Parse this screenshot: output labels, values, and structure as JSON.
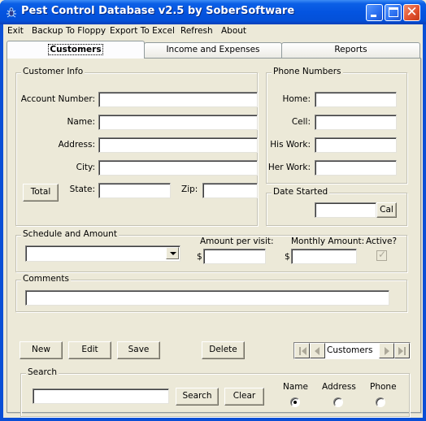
{
  "window": {
    "title": "Pest Control Database v2.5 by SoberSoftware",
    "app_icon": "bug-icon",
    "controls": [
      "minimize-icon",
      "maximize-icon",
      "close-icon"
    ],
    "close_glyph": "✕"
  },
  "menu": {
    "items": [
      {
        "label": "Exit"
      },
      {
        "label": "Backup To Floppy"
      },
      {
        "label": "Export To Excel"
      },
      {
        "label": "Refresh"
      },
      {
        "label": "About"
      }
    ]
  },
  "tabs": [
    {
      "label": "Customers",
      "active": true
    },
    {
      "label": "Income and Expenses",
      "active": false
    },
    {
      "label": "Reports",
      "active": false
    }
  ],
  "customer_info": {
    "title": "Customer Info",
    "account_number": {
      "label": "Account Number:",
      "value": ""
    },
    "name": {
      "label": "Name:",
      "value": ""
    },
    "address": {
      "label": "Address:",
      "value": ""
    },
    "city": {
      "label": "City:",
      "value": ""
    },
    "state": {
      "label": "State:",
      "value": ""
    },
    "zip": {
      "label": "Zip:",
      "value": ""
    },
    "total_button": "Total"
  },
  "phone_numbers": {
    "title": "Phone Numbers",
    "home": {
      "label": "Home:",
      "value": ""
    },
    "cell": {
      "label": "Cell:",
      "value": ""
    },
    "his_work": {
      "label": "His Work:",
      "value": ""
    },
    "her_work": {
      "label": "Her Work:",
      "value": ""
    }
  },
  "date_started": {
    "title": "Date Started",
    "value": "",
    "cal_button": "Cal"
  },
  "schedule": {
    "title": "Schedule and Amount",
    "schedule_value": "",
    "amount_per_visit_label": "Amount per visit:",
    "amount_per_visit_value": "",
    "monthly_amount_label": "Monthly Amount:",
    "monthly_amount_value": "",
    "currency": "$",
    "active_label": "Active?",
    "active_checked": true,
    "active_enabled": false
  },
  "comments": {
    "title": "Comments",
    "value": ""
  },
  "actions": {
    "new": "New",
    "edit": "Edit",
    "save": "Save",
    "delete": "Delete"
  },
  "navigator": {
    "label": "Customers",
    "buttons": [
      "first-record-icon",
      "previous-record-icon",
      "next-record-icon",
      "last-record-icon"
    ]
  },
  "search": {
    "title": "Search",
    "value": "",
    "search_button": "Search",
    "clear_button": "Clear",
    "options": [
      {
        "label": "Name",
        "checked": true
      },
      {
        "label": "Address",
        "checked": false
      },
      {
        "label": "Phone",
        "checked": false
      }
    ]
  }
}
